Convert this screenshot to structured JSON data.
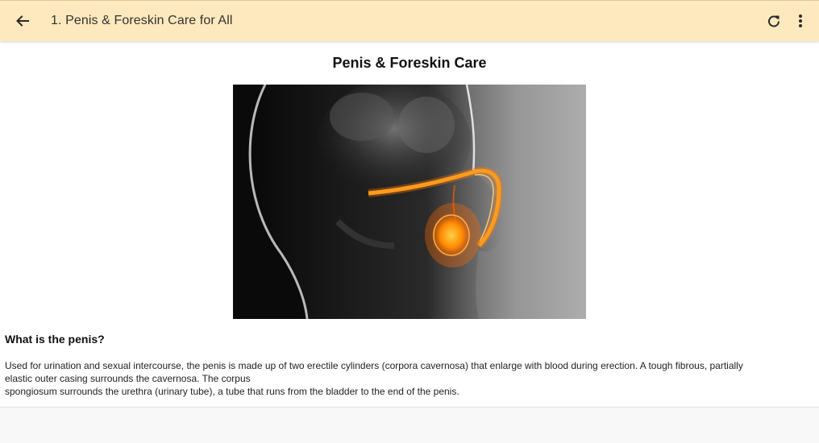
{
  "toolbar": {
    "title": "1. Penis & Foreskin Care for All",
    "back_icon": "arrow-left-icon",
    "refresh_icon": "refresh-icon",
    "menu_icon": "more-vert-icon",
    "background_color": "#fde9bd"
  },
  "article": {
    "heading": "Penis & Foreskin Care",
    "section_title": "What is the penis?",
    "body_line_1": "Used for urination and sexual intercourse, the penis is made up of two erectile cylinders (corpora cavernosa) that enlarge with blood during erection. A tough fibrous, partially",
    "body_line_2": "elastic outer casing surrounds the cavernosa. The corpus",
    "body_line_3": "spongiosum surrounds the urethra (urinary tube), a tube that runs from the bladder to the end of the penis."
  }
}
